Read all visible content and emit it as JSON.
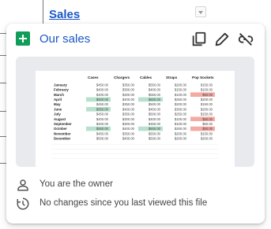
{
  "background": {
    "cell_link_text": "Sales"
  },
  "card": {
    "title": "Our sales",
    "actions": {
      "copy": "copy-icon",
      "edit": "pencil-icon",
      "unlink": "unlink-icon"
    },
    "preview": {
      "columns": [
        "Cases",
        "Chargers",
        "Cables",
        "Straps",
        "Pop Sockets"
      ],
      "rows": [
        {
          "month": "January",
          "values": [
            "$450.00",
            "$350.00",
            "$550.00",
            "$200.00",
            "$150.00"
          ],
          "hl": [
            "",
            "",
            "",
            "",
            ""
          ]
        },
        {
          "month": "February",
          "values": [
            "$400.00",
            "$300.00",
            "$400.00",
            "$150.00",
            "$100.00"
          ],
          "hl": [
            "",
            "",
            "",
            "",
            ""
          ]
        },
        {
          "month": "March",
          "values": [
            "$400.00",
            "$300.00",
            "$550.00",
            "$100.00",
            "$50.00"
          ],
          "hl": [
            "",
            "",
            "",
            "",
            "red"
          ]
        },
        {
          "month": "April",
          "values": [
            "$600.00",
            "$400.00",
            "$600.00",
            "$250.00",
            "$200.00"
          ],
          "hl": [
            "green",
            "",
            "green",
            "",
            ""
          ]
        },
        {
          "month": "May",
          "values": [
            "$450.00",
            "$350.00",
            "$500.00",
            "$200.00",
            "$150.00"
          ],
          "hl": [
            "",
            "",
            "",
            "",
            ""
          ]
        },
        {
          "month": "June",
          "values": [
            "$650.00",
            "$400.00",
            "$450.00",
            "$300.00",
            "$200.00"
          ],
          "hl": [
            "green",
            "",
            "",
            "",
            ""
          ]
        },
        {
          "month": "July",
          "values": [
            "$450.00",
            "$350.00",
            "$500.00",
            "$250.00",
            "$150.00"
          ],
          "hl": [
            "",
            "",
            "",
            "",
            ""
          ]
        },
        {
          "month": "August",
          "values": [
            "$400.00",
            "$300.00",
            "$400.00",
            "$100.00",
            "$50.00"
          ],
          "hl": [
            "",
            "",
            "",
            "",
            "red"
          ]
        },
        {
          "month": "September",
          "values": [
            "$400.00",
            "$300.00",
            "$450.00",
            "$100.00",
            "$50.00"
          ],
          "hl": [
            "",
            "",
            "",
            "",
            ""
          ]
        },
        {
          "month": "October",
          "values": [
            "$550.00",
            "$400.00",
            "$600.00",
            "$250.00",
            "$50.00"
          ],
          "hl": [
            "green",
            "",
            "green",
            "",
            "red"
          ]
        },
        {
          "month": "November",
          "values": [
            "$450.00",
            "$350.00",
            "$500.00",
            "$200.00",
            "$150.00"
          ],
          "hl": [
            "",
            "",
            "",
            "",
            ""
          ]
        },
        {
          "month": "December",
          "values": [
            "$500.00",
            "$400.00",
            "$500.00",
            "$200.00",
            "$200.00"
          ],
          "hl": [
            "",
            "",
            "",
            "",
            ""
          ]
        }
      ],
      "colors": {
        "green": "#b7e1cd",
        "red": "#f4a9a3"
      }
    },
    "owner_text": "You are the owner",
    "changes_text": "No changes since you last viewed this file"
  },
  "colors": {
    "accent": "#1a57c7",
    "sheets_green": "#0f9d58"
  }
}
